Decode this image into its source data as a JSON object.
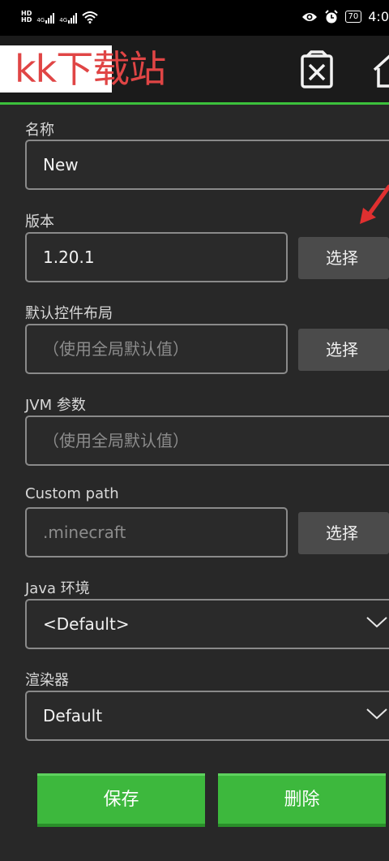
{
  "status_bar": {
    "hd1": "HD",
    "hd2": "HD",
    "signal1": "4G",
    "signal2": "4G",
    "battery": "70",
    "time": "4:0"
  },
  "watermark": {
    "text": "kk下载站"
  },
  "toolbar": {
    "delete_icon": "delete-icon",
    "home_icon": "home-icon"
  },
  "form": {
    "name": {
      "label": "名称",
      "value": "New"
    },
    "version": {
      "label": "版本",
      "value": "1.20.1",
      "button": "选择"
    },
    "control_layout": {
      "label": "默认控件布局",
      "placeholder": "（使用全局默认值）",
      "button": "选择"
    },
    "jvm_args": {
      "label": "JVM 参数",
      "placeholder": "（使用全局默认值）"
    },
    "custom_path": {
      "label": "Custom path",
      "placeholder": ".minecraft",
      "button": "选择"
    },
    "java_env": {
      "label": "Java 环境",
      "value": "<Default>"
    },
    "renderer": {
      "label": "渲染器",
      "value": "Default"
    }
  },
  "actions": {
    "save": "保存",
    "delete": "删除"
  },
  "colors": {
    "accent": "#3db83d",
    "background": "#282828",
    "arrow": "#e03030"
  }
}
